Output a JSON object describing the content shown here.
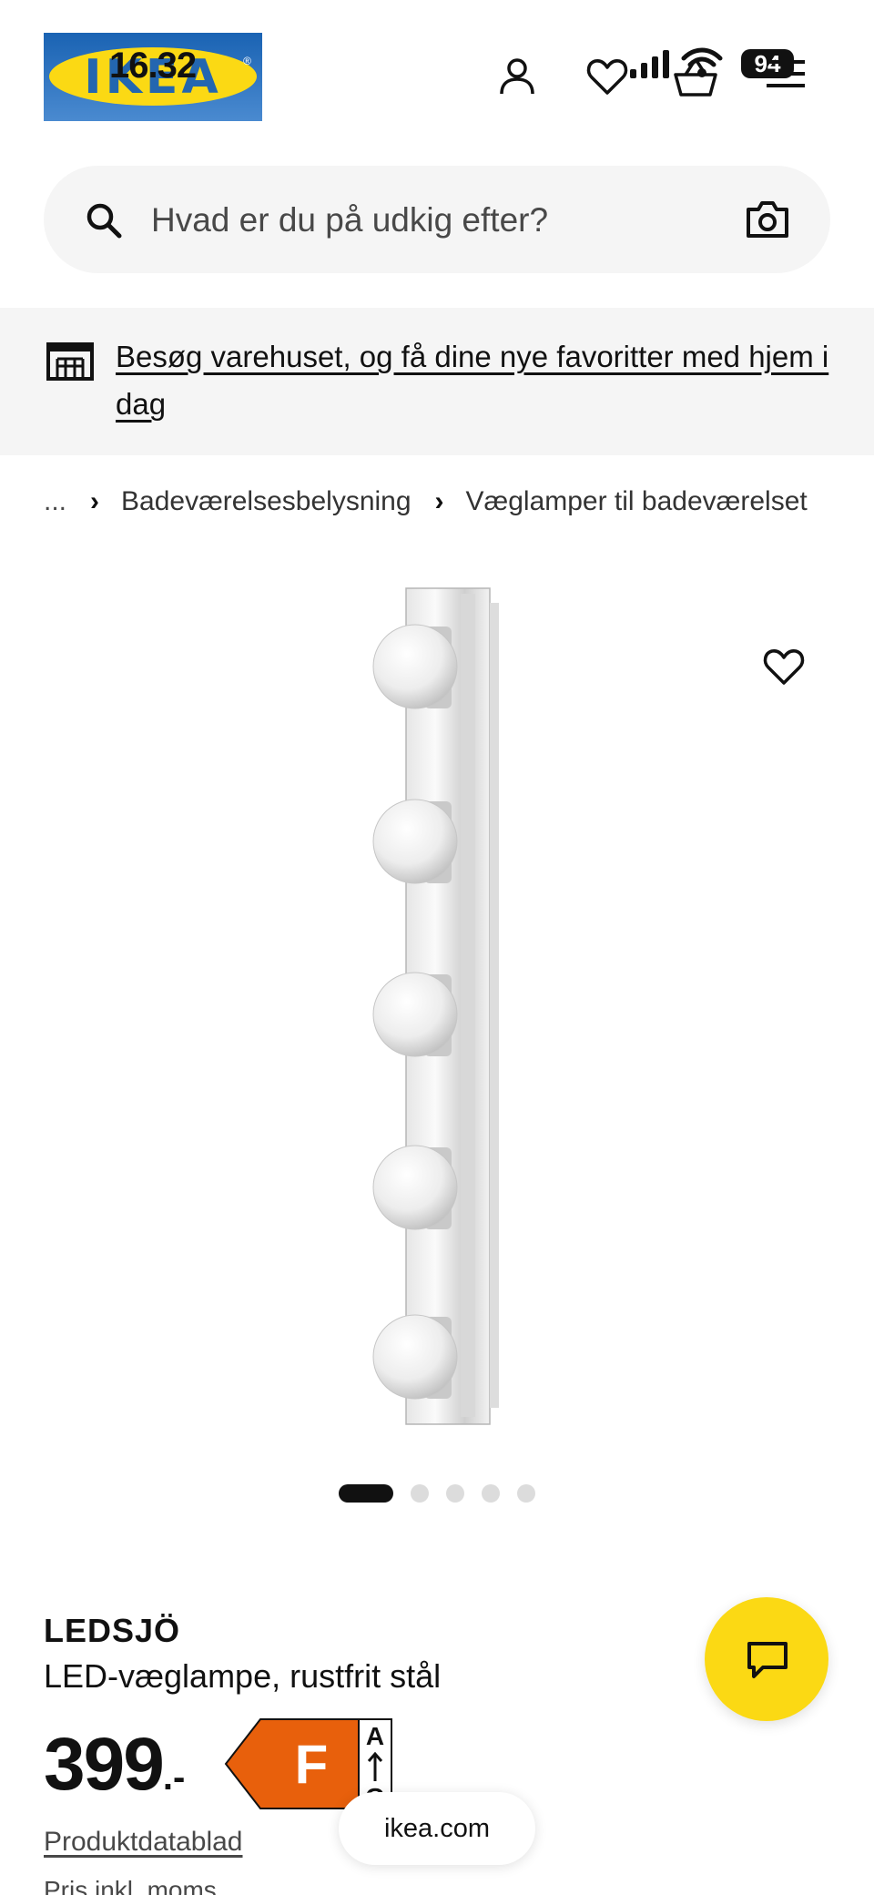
{
  "status_bar": {
    "time": "16.32",
    "battery": "94"
  },
  "header": {
    "logo_text": "IKEA",
    "icons": [
      "user-icon",
      "heart-icon",
      "basket-icon",
      "menu-icon"
    ]
  },
  "search": {
    "placeholder": "Hvad er du på udkig efter?",
    "value": ""
  },
  "store_banner": {
    "link_text": "Besøg varehuset, og få dine nye favoritter med hjem i dag"
  },
  "breadcrumb": {
    "ellipsis": "...",
    "items": [
      "Badeværelsesbelysning",
      "Væglamper til badeværelset"
    ]
  },
  "carousel": {
    "total": 5,
    "active_index": 0
  },
  "product": {
    "name": "LEDSJÖ",
    "description": "LED-væglampe, rustfrit stål",
    "price": "399",
    "price_suffix": ".-",
    "energy_class": "F",
    "energy_scale_top": "A",
    "energy_scale_bottom": "G",
    "datasheet_label": "Produktdatablad",
    "price_note": "Pris inkl. moms"
  },
  "browser": {
    "url": "ikea.com"
  },
  "colors": {
    "brand_yellow": "#fbd914",
    "brand_blue": "#0058a3",
    "energy_orange": "#e8600c",
    "surface_grey": "#f5f5f5"
  }
}
